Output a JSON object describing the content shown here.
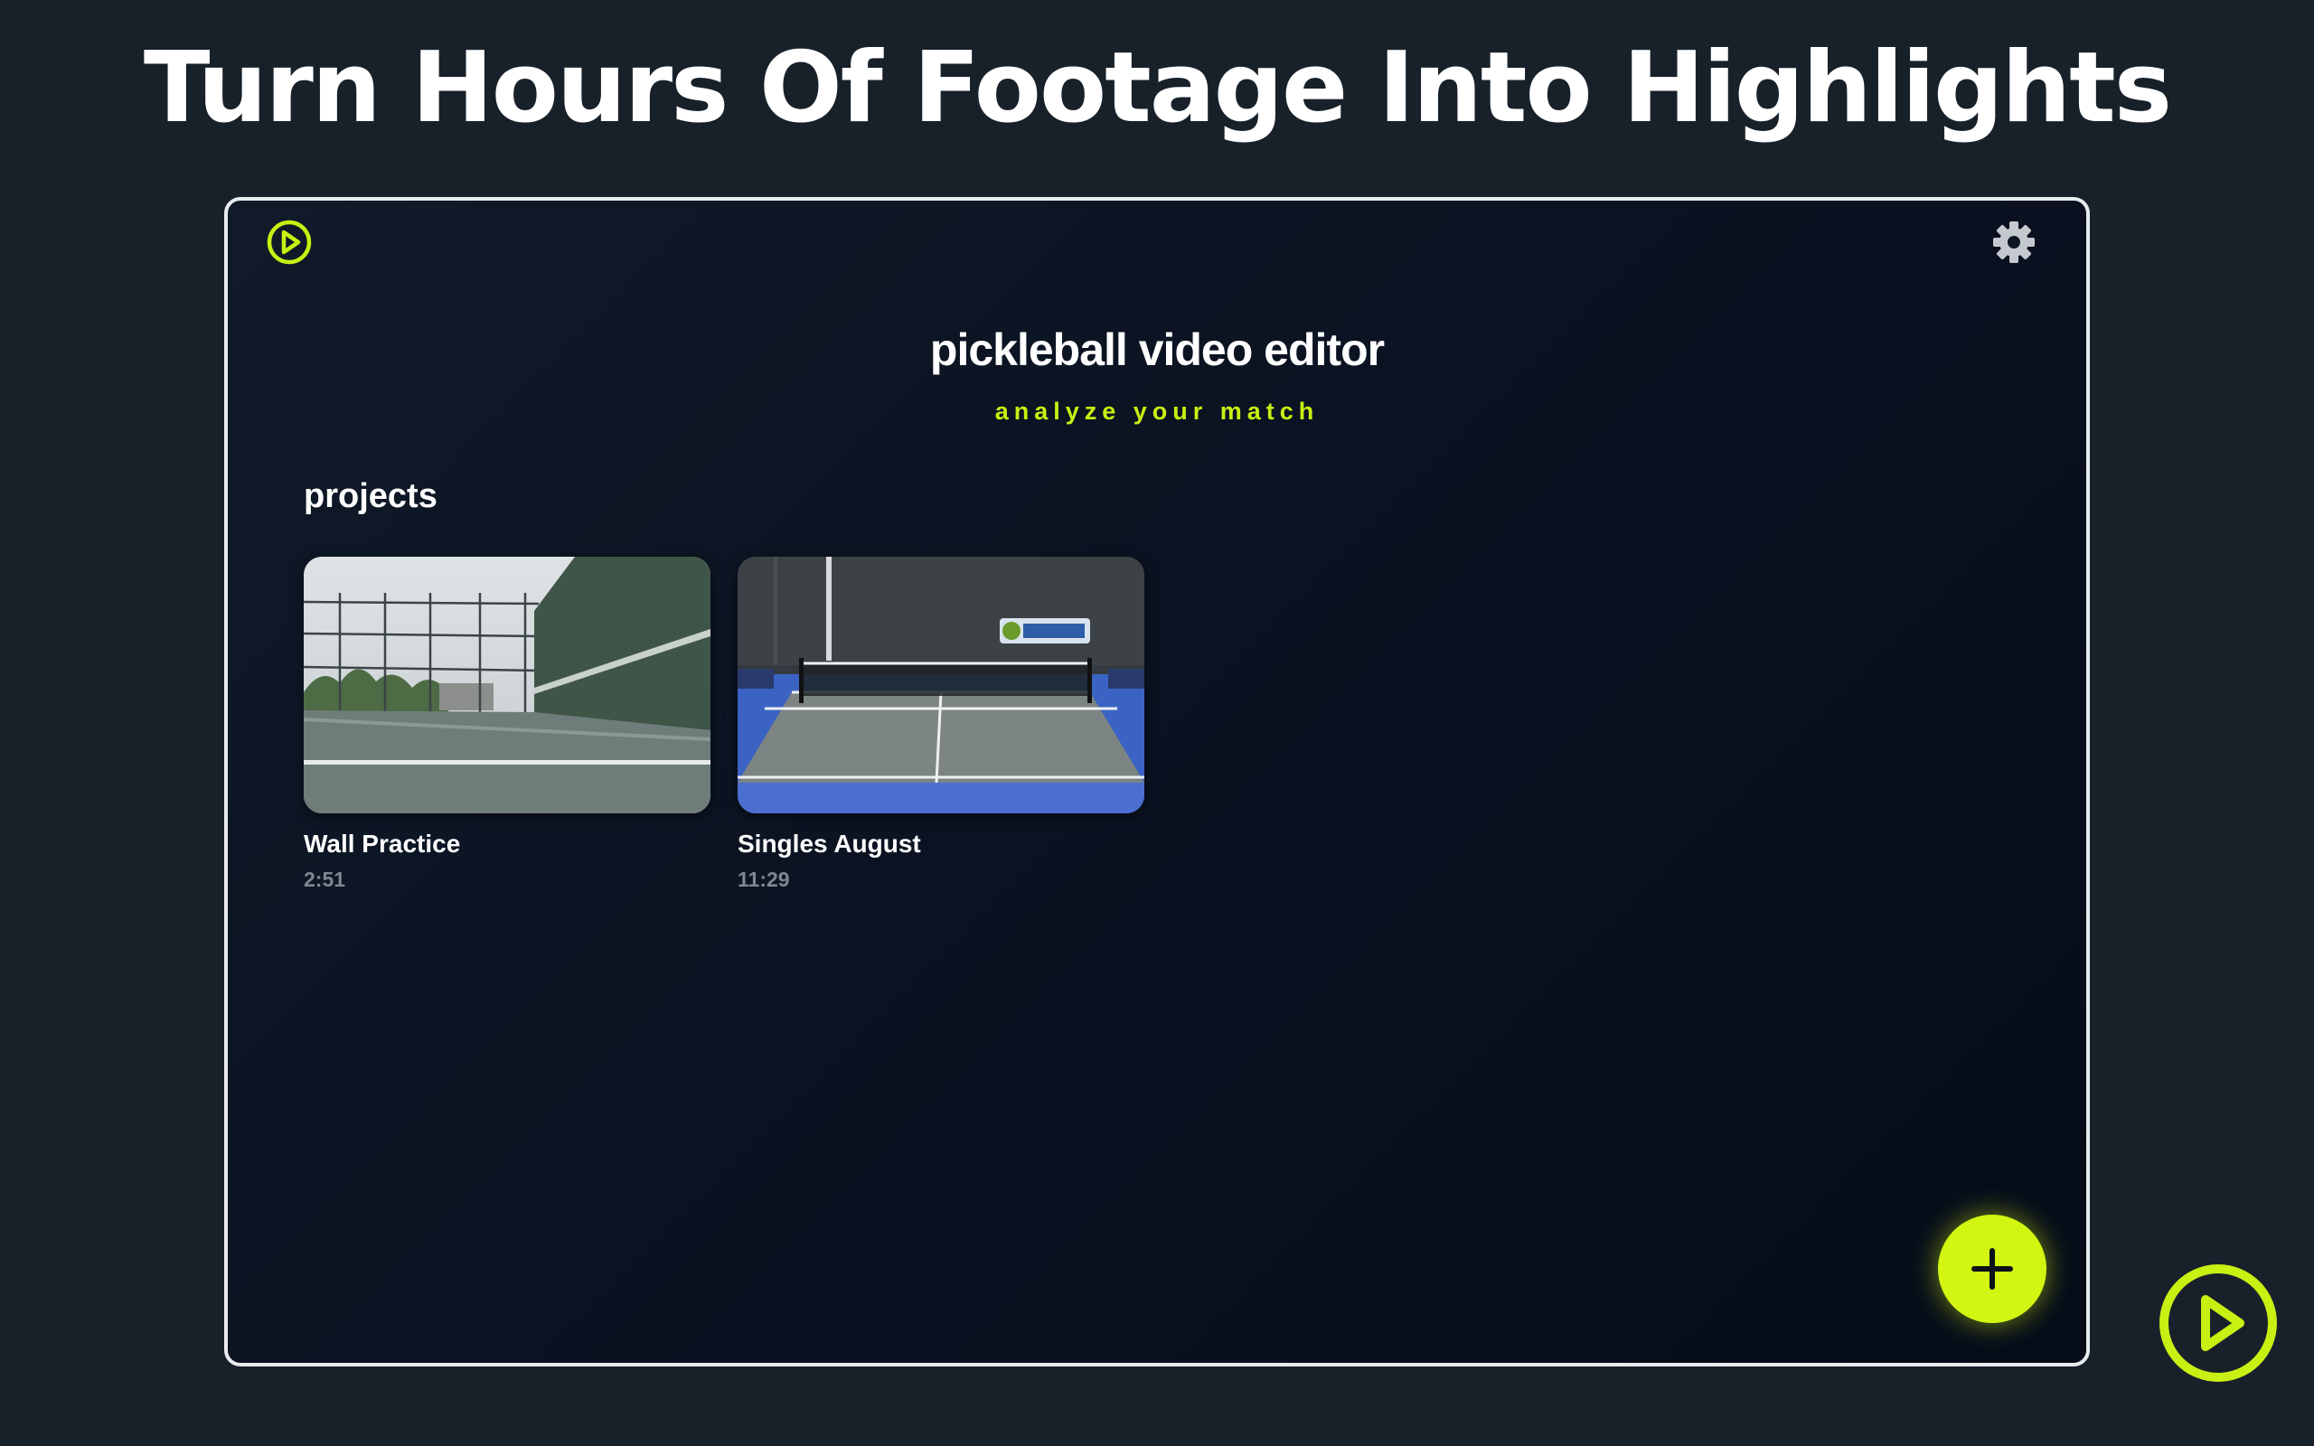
{
  "page": {
    "headline": "Turn Hours Of Footage Into Highlights"
  },
  "app": {
    "title": "pickleball video editor",
    "subtitle": "analyze your match",
    "accent_color": "#d2f511",
    "logo_icon": "play-circle-icon",
    "settings_icon": "gear-icon",
    "add_icon": "plus-icon"
  },
  "projects": {
    "heading": "projects",
    "items": [
      {
        "name": "Wall Practice",
        "duration": "2:51",
        "thumbnail": "outdoor court with practice wall"
      },
      {
        "name": "Singles August",
        "duration": "11:29",
        "thumbnail": "indoor blue pickleball court with net"
      }
    ]
  }
}
